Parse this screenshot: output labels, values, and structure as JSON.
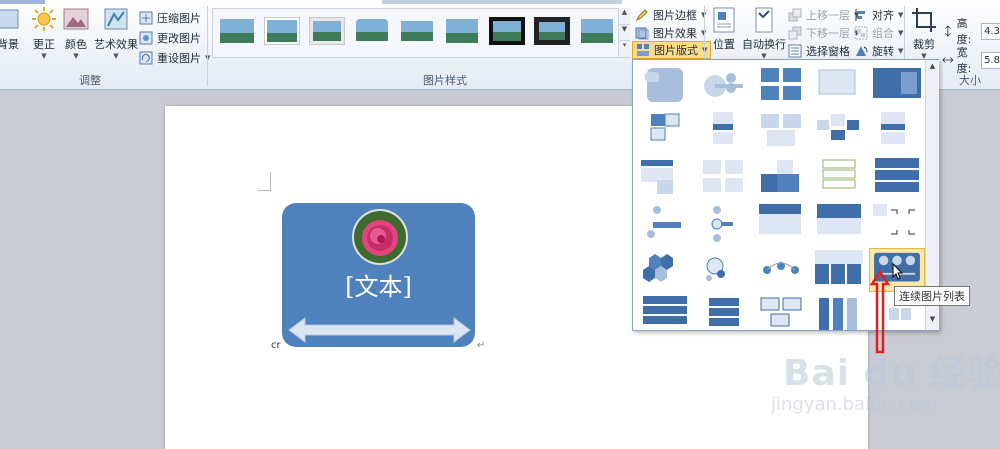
{
  "adjust_group": {
    "label": "调整",
    "background_label": "背景",
    "corrections_label": "更正",
    "color_label": "颜色",
    "artistic_effects_label": "艺术效果",
    "compress_label": "压缩图片",
    "change_label": "更改图片",
    "reset_label": "重设图片"
  },
  "picture_styles_group": {
    "label": "图片样式",
    "border_label": "图片边框",
    "effects_label": "图片效果",
    "layout_label": "图片版式"
  },
  "arrange_group": {
    "position_label": "位置",
    "wrap_label": "自动换行",
    "bring_forward_label": "上移一层",
    "send_backward_label": "下移一层",
    "selection_pane_label": "选择窗格",
    "align_label": "对齐",
    "group_label": "组合",
    "rotate_label": "旋转"
  },
  "size_group": {
    "label": "大小",
    "crop_label": "裁剪",
    "height_label": "高度:",
    "height_value": "4.3",
    "width_label": "宽度:",
    "width_value": "5.8"
  },
  "document": {
    "smartart_placeholder": "[文本]",
    "cr_mark": "cr",
    "paragraph_mark": "↵"
  },
  "layout_gallery": {
    "tooltip": "连续图片列表"
  },
  "watermark": {
    "logo_text": "Bai du 经验",
    "url_text": "jingyan.baidu.com"
  },
  "colors": {
    "smartart_fill": "#4f81bd",
    "annotation_red": "#e02020",
    "selected_cell": "#fde7a6"
  }
}
